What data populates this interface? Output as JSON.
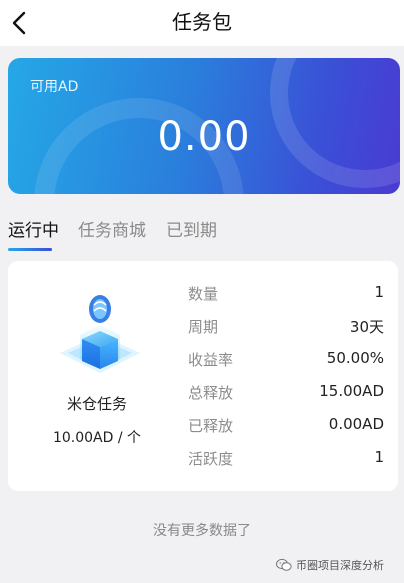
{
  "header": {
    "title": "任务包"
  },
  "balance": {
    "label": "可用AD",
    "value": "0.00"
  },
  "tabs": [
    {
      "label": "运行中",
      "active": true
    },
    {
      "label": "任务商城",
      "active": false
    },
    {
      "label": "已到期",
      "active": false
    }
  ],
  "task": {
    "name": "米仓任务",
    "price": "10.00AD / 个",
    "stats": [
      {
        "label": "数量",
        "value": "1"
      },
      {
        "label": "周期",
        "value": "30天"
      },
      {
        "label": "收益率",
        "value": "50.00%"
      },
      {
        "label": "总释放",
        "value": "15.00AD"
      },
      {
        "label": "已释放",
        "value": "0.00AD"
      },
      {
        "label": "活跃度",
        "value": "1"
      }
    ]
  },
  "footer": {
    "no_more": "没有更多数据了"
  },
  "watermark": {
    "text": "币圈项目深度分析"
  },
  "colors": {
    "accent_start": "#25a8e6",
    "accent_end": "#4a3bd2",
    "page_bg": "#f1f1f3"
  }
}
